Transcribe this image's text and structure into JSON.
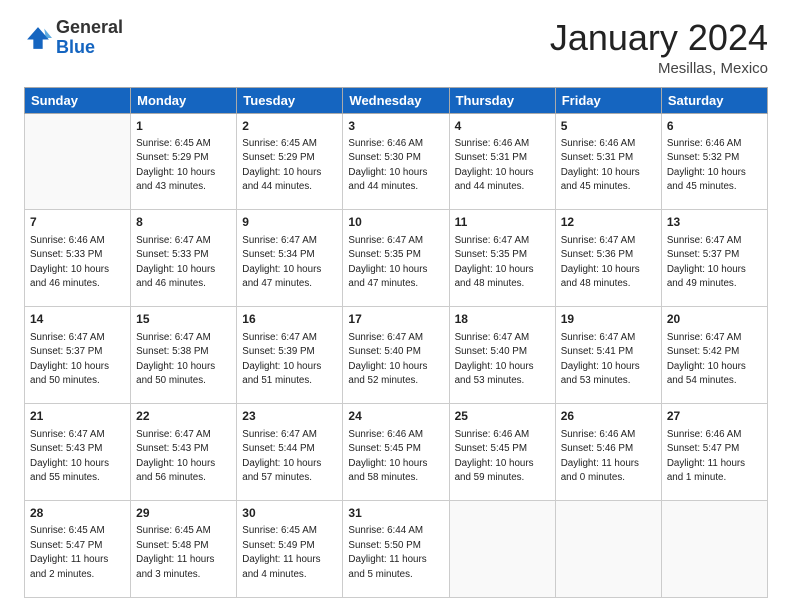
{
  "header": {
    "logo_general": "General",
    "logo_blue": "Blue",
    "month_title": "January 2024",
    "location": "Mesillas, Mexico"
  },
  "weekdays": [
    "Sunday",
    "Monday",
    "Tuesday",
    "Wednesday",
    "Thursday",
    "Friday",
    "Saturday"
  ],
  "weeks": [
    [
      {
        "day": "",
        "info": ""
      },
      {
        "day": "1",
        "info": "Sunrise: 6:45 AM\nSunset: 5:29 PM\nDaylight: 10 hours\nand 43 minutes."
      },
      {
        "day": "2",
        "info": "Sunrise: 6:45 AM\nSunset: 5:29 PM\nDaylight: 10 hours\nand 44 minutes."
      },
      {
        "day": "3",
        "info": "Sunrise: 6:46 AM\nSunset: 5:30 PM\nDaylight: 10 hours\nand 44 minutes."
      },
      {
        "day": "4",
        "info": "Sunrise: 6:46 AM\nSunset: 5:31 PM\nDaylight: 10 hours\nand 44 minutes."
      },
      {
        "day": "5",
        "info": "Sunrise: 6:46 AM\nSunset: 5:31 PM\nDaylight: 10 hours\nand 45 minutes."
      },
      {
        "day": "6",
        "info": "Sunrise: 6:46 AM\nSunset: 5:32 PM\nDaylight: 10 hours\nand 45 minutes."
      }
    ],
    [
      {
        "day": "7",
        "info": "Sunrise: 6:46 AM\nSunset: 5:33 PM\nDaylight: 10 hours\nand 46 minutes."
      },
      {
        "day": "8",
        "info": "Sunrise: 6:47 AM\nSunset: 5:33 PM\nDaylight: 10 hours\nand 46 minutes."
      },
      {
        "day": "9",
        "info": "Sunrise: 6:47 AM\nSunset: 5:34 PM\nDaylight: 10 hours\nand 47 minutes."
      },
      {
        "day": "10",
        "info": "Sunrise: 6:47 AM\nSunset: 5:35 PM\nDaylight: 10 hours\nand 47 minutes."
      },
      {
        "day": "11",
        "info": "Sunrise: 6:47 AM\nSunset: 5:35 PM\nDaylight: 10 hours\nand 48 minutes."
      },
      {
        "day": "12",
        "info": "Sunrise: 6:47 AM\nSunset: 5:36 PM\nDaylight: 10 hours\nand 48 minutes."
      },
      {
        "day": "13",
        "info": "Sunrise: 6:47 AM\nSunset: 5:37 PM\nDaylight: 10 hours\nand 49 minutes."
      }
    ],
    [
      {
        "day": "14",
        "info": "Sunrise: 6:47 AM\nSunset: 5:37 PM\nDaylight: 10 hours\nand 50 minutes."
      },
      {
        "day": "15",
        "info": "Sunrise: 6:47 AM\nSunset: 5:38 PM\nDaylight: 10 hours\nand 50 minutes."
      },
      {
        "day": "16",
        "info": "Sunrise: 6:47 AM\nSunset: 5:39 PM\nDaylight: 10 hours\nand 51 minutes."
      },
      {
        "day": "17",
        "info": "Sunrise: 6:47 AM\nSunset: 5:40 PM\nDaylight: 10 hours\nand 52 minutes."
      },
      {
        "day": "18",
        "info": "Sunrise: 6:47 AM\nSunset: 5:40 PM\nDaylight: 10 hours\nand 53 minutes."
      },
      {
        "day": "19",
        "info": "Sunrise: 6:47 AM\nSunset: 5:41 PM\nDaylight: 10 hours\nand 53 minutes."
      },
      {
        "day": "20",
        "info": "Sunrise: 6:47 AM\nSunset: 5:42 PM\nDaylight: 10 hours\nand 54 minutes."
      }
    ],
    [
      {
        "day": "21",
        "info": "Sunrise: 6:47 AM\nSunset: 5:43 PM\nDaylight: 10 hours\nand 55 minutes."
      },
      {
        "day": "22",
        "info": "Sunrise: 6:47 AM\nSunset: 5:43 PM\nDaylight: 10 hours\nand 56 minutes."
      },
      {
        "day": "23",
        "info": "Sunrise: 6:47 AM\nSunset: 5:44 PM\nDaylight: 10 hours\nand 57 minutes."
      },
      {
        "day": "24",
        "info": "Sunrise: 6:46 AM\nSunset: 5:45 PM\nDaylight: 10 hours\nand 58 minutes."
      },
      {
        "day": "25",
        "info": "Sunrise: 6:46 AM\nSunset: 5:45 PM\nDaylight: 10 hours\nand 59 minutes."
      },
      {
        "day": "26",
        "info": "Sunrise: 6:46 AM\nSunset: 5:46 PM\nDaylight: 11 hours\nand 0 minutes."
      },
      {
        "day": "27",
        "info": "Sunrise: 6:46 AM\nSunset: 5:47 PM\nDaylight: 11 hours\nand 1 minute."
      }
    ],
    [
      {
        "day": "28",
        "info": "Sunrise: 6:45 AM\nSunset: 5:47 PM\nDaylight: 11 hours\nand 2 minutes."
      },
      {
        "day": "29",
        "info": "Sunrise: 6:45 AM\nSunset: 5:48 PM\nDaylight: 11 hours\nand 3 minutes."
      },
      {
        "day": "30",
        "info": "Sunrise: 6:45 AM\nSunset: 5:49 PM\nDaylight: 11 hours\nand 4 minutes."
      },
      {
        "day": "31",
        "info": "Sunrise: 6:44 AM\nSunset: 5:50 PM\nDaylight: 11 hours\nand 5 minutes."
      },
      {
        "day": "",
        "info": ""
      },
      {
        "day": "",
        "info": ""
      },
      {
        "day": "",
        "info": ""
      }
    ]
  ]
}
